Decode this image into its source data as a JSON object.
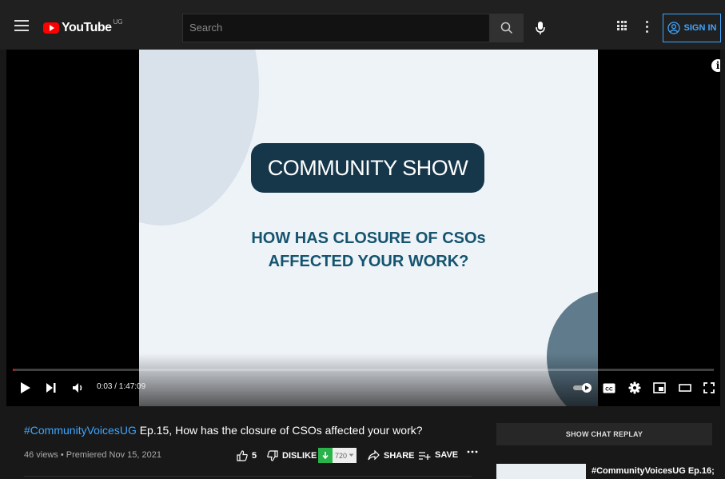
{
  "header": {
    "logo_text": "YouTube",
    "country_code": "UG",
    "search_placeholder": "Search",
    "signin_label": "SIGN IN"
  },
  "video": {
    "slide_heading": "COMMUNITY SHOW",
    "slide_question_line1": "HOW HAS CLOSURE OF CSOs",
    "slide_question_line2": "AFFECTED YOUR WORK?",
    "progress_fraction": 0.0005
  },
  "player_controls": {
    "time_display": "0:03 / 1:47:09"
  },
  "details": {
    "title_hashtag": "#CommunityVoicesUG",
    "title_rest": " Ep.15, How has the closure of CSOs affected your work?",
    "meta": "46 views • Premiered Nov 15, 2021",
    "like_count": "5",
    "dislike_label": "DISLIKE",
    "download_count": "720",
    "share_label": "SHARE",
    "save_label": "SAVE"
  },
  "sidebar": {
    "chat_replay_label": "SHOW CHAT REPLAY",
    "rec_title": "#CommunityVoicesUG Ep.16;"
  },
  "colors": {
    "accent_blue": "#3ea6ff",
    "brand_red": "#ff0000",
    "slide_navy": "#16364a",
    "slide_teal": "#15546e"
  }
}
